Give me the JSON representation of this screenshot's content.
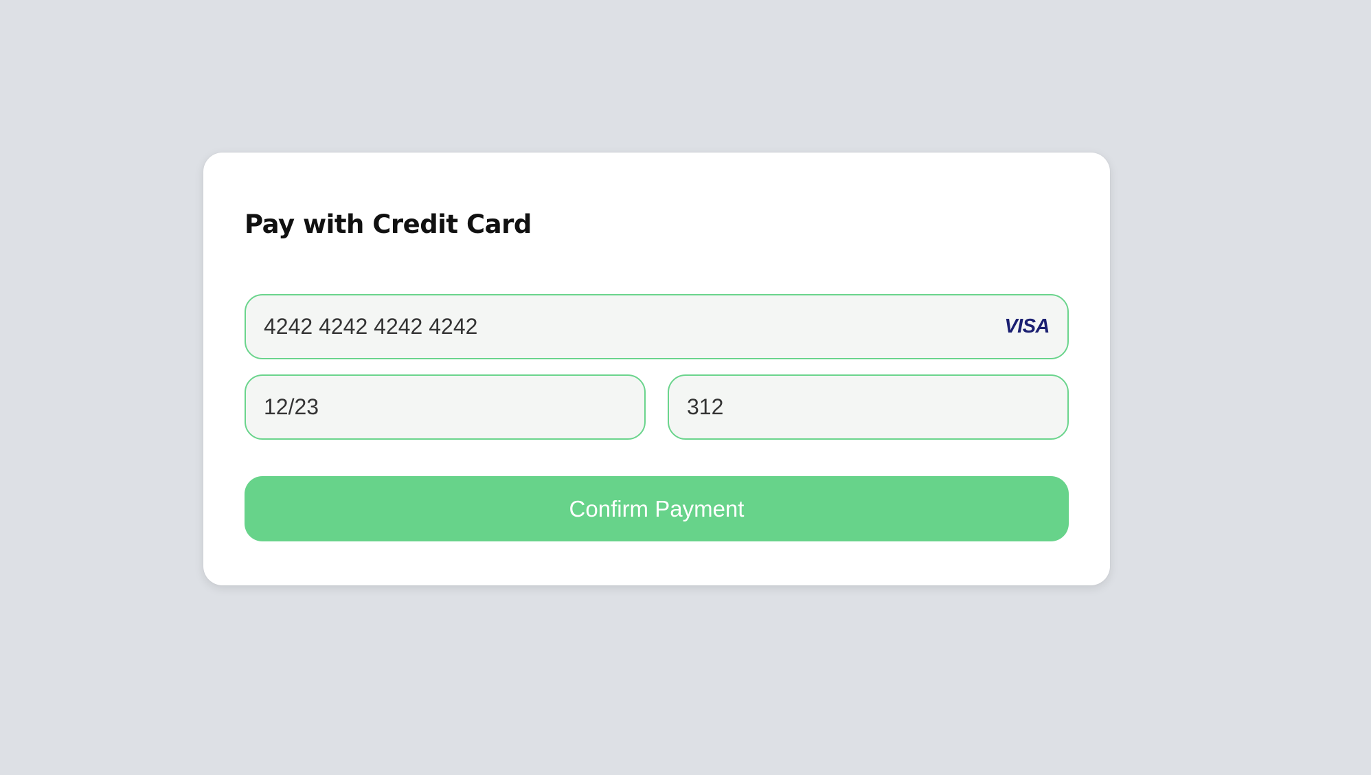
{
  "form": {
    "title": "Pay with Credit Card",
    "card_number": {
      "value": "4242 4242 4242 4242",
      "brand_label": "VISA",
      "brand_icon": "visa-logo-icon"
    },
    "expiry": {
      "value": "12/23"
    },
    "cvc": {
      "value": "312"
    },
    "confirm_label": "Confirm Payment"
  },
  "colors": {
    "page_background": "#dde0e5",
    "card_background": "#ffffff",
    "field_background": "#f4f6f4",
    "field_border": "#6ad48c",
    "button_background": "#67d38a",
    "button_text": "#ffffff",
    "visa_brand": "#1a1f71"
  }
}
